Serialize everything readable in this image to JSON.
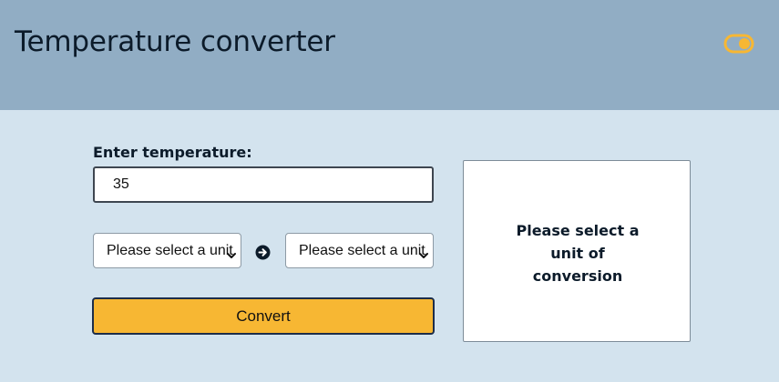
{
  "header": {
    "title": "Temperature converter",
    "theme_toggle_icon": "toggle-switch-icon",
    "accent_color": "#f7b733",
    "background_color": "#91adc4"
  },
  "form": {
    "temperature_label": "Enter temperature:",
    "temperature_value": "35",
    "from_unit": {
      "selected": "Please select a unit"
    },
    "direction_icon": "arrow-right-circle-icon",
    "to_unit": {
      "selected": "Please select a unit"
    },
    "convert_label": "Convert"
  },
  "result": {
    "message": "Please select a unit of conversion"
  }
}
